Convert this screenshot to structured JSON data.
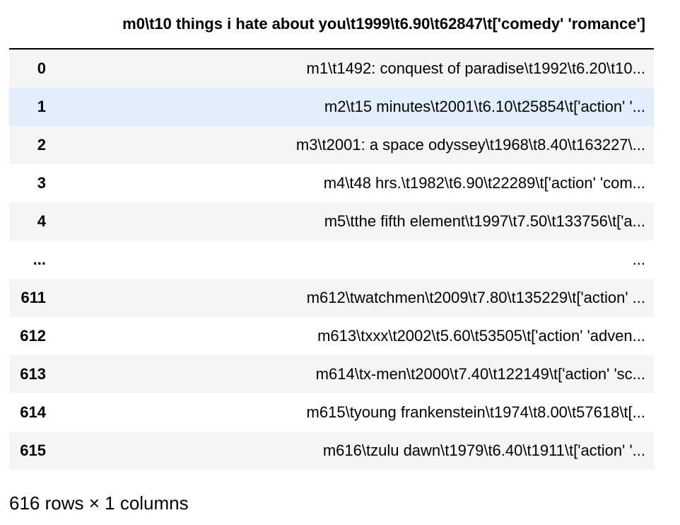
{
  "table": {
    "index_header": "",
    "column_header": "m0\\t10 things i hate about you\\t1999\\t6.90\\t62847\\t['comedy' 'romance']",
    "rows": [
      {
        "index": "0",
        "value": "m1\\t1492: conquest of paradise\\t1992\\t6.20\\t10..."
      },
      {
        "index": "1",
        "value": "m2\\t15 minutes\\t2001\\t6.10\\t25854\\t['action' '..."
      },
      {
        "index": "2",
        "value": "m3\\t2001: a space odyssey\\t1968\\t8.40\\t163227\\..."
      },
      {
        "index": "3",
        "value": "m4\\t48 hrs.\\t1982\\t6.90\\t22289\\t['action' 'com..."
      },
      {
        "index": "4",
        "value": "m5\\tthe fifth element\\t1997\\t7.50\\t133756\\t['a..."
      },
      {
        "index": "...",
        "value": "..."
      },
      {
        "index": "611",
        "value": "m612\\twatchmen\\t2009\\t7.80\\t135229\\t['action' ..."
      },
      {
        "index": "612",
        "value": "m613\\txxx\\t2002\\t5.60\\t53505\\t['action' 'adven..."
      },
      {
        "index": "613",
        "value": "m614\\tx-men\\t2000\\t7.40\\t122149\\t['action' 'sc..."
      },
      {
        "index": "614",
        "value": "m615\\tyoung frankenstein\\t1974\\t8.00\\t57618\\t[..."
      },
      {
        "index": "615",
        "value": "m616\\tzulu dawn\\t1979\\t6.40\\t1911\\t['action' '..."
      }
    ]
  },
  "footer": {
    "shape_text": "616 rows × 1 columns"
  },
  "colors": {
    "stripe": "#f5f5f5",
    "hover_row": "#e1eefb",
    "header_rule": "#000000"
  }
}
